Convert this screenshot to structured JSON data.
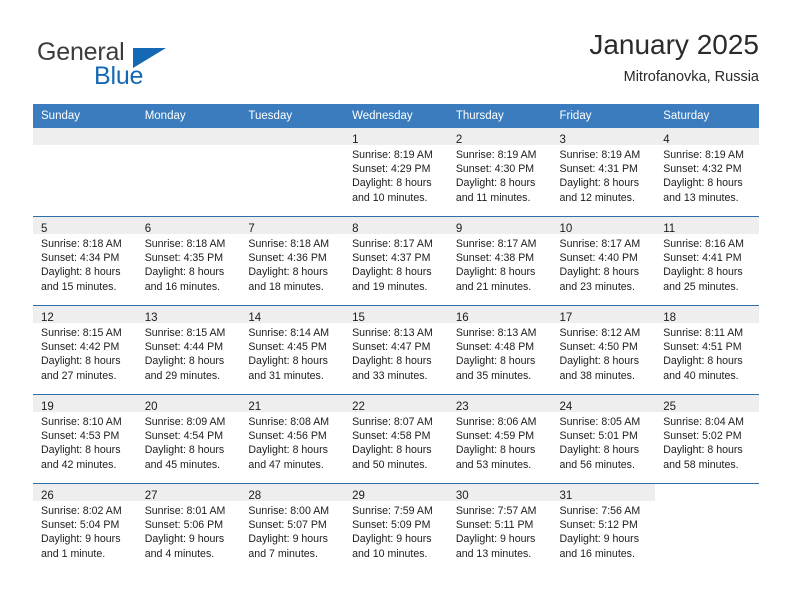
{
  "brand": {
    "name_top": "General",
    "name_bottom": "Blue",
    "accent_color": "#1569b4",
    "triangle_icon": "brand-triangle-icon"
  },
  "header": {
    "title": "January 2025",
    "subtitle": "Mitrofanovka, Russia"
  },
  "colors": {
    "header_row_bg": "#3a7cbe",
    "week_divider": "#2f6ea8",
    "daynum_band_bg": "#eeeeee",
    "text": "#1c1c1c"
  },
  "weekdays": [
    "Sunday",
    "Monday",
    "Tuesday",
    "Wednesday",
    "Thursday",
    "Friday",
    "Saturday"
  ],
  "weeks": [
    [
      {
        "day": "",
        "lines": [
          "",
          "",
          "",
          ""
        ]
      },
      {
        "day": "",
        "lines": [
          "",
          "",
          "",
          ""
        ]
      },
      {
        "day": "",
        "lines": [
          "",
          "",
          "",
          ""
        ]
      },
      {
        "day": "1",
        "lines": [
          "Sunrise: 8:19 AM",
          "Sunset: 4:29 PM",
          "Daylight: 8 hours",
          "and 10 minutes."
        ]
      },
      {
        "day": "2",
        "lines": [
          "Sunrise: 8:19 AM",
          "Sunset: 4:30 PM",
          "Daylight: 8 hours",
          "and 11 minutes."
        ]
      },
      {
        "day": "3",
        "lines": [
          "Sunrise: 8:19 AM",
          "Sunset: 4:31 PM",
          "Daylight: 8 hours",
          "and 12 minutes."
        ]
      },
      {
        "day": "4",
        "lines": [
          "Sunrise: 8:19 AM",
          "Sunset: 4:32 PM",
          "Daylight: 8 hours",
          "and 13 minutes."
        ]
      }
    ],
    [
      {
        "day": "5",
        "lines": [
          "Sunrise: 8:18 AM",
          "Sunset: 4:34 PM",
          "Daylight: 8 hours",
          "and 15 minutes."
        ]
      },
      {
        "day": "6",
        "lines": [
          "Sunrise: 8:18 AM",
          "Sunset: 4:35 PM",
          "Daylight: 8 hours",
          "and 16 minutes."
        ]
      },
      {
        "day": "7",
        "lines": [
          "Sunrise: 8:18 AM",
          "Sunset: 4:36 PM",
          "Daylight: 8 hours",
          "and 18 minutes."
        ]
      },
      {
        "day": "8",
        "lines": [
          "Sunrise: 8:17 AM",
          "Sunset: 4:37 PM",
          "Daylight: 8 hours",
          "and 19 minutes."
        ]
      },
      {
        "day": "9",
        "lines": [
          "Sunrise: 8:17 AM",
          "Sunset: 4:38 PM",
          "Daylight: 8 hours",
          "and 21 minutes."
        ]
      },
      {
        "day": "10",
        "lines": [
          "Sunrise: 8:17 AM",
          "Sunset: 4:40 PM",
          "Daylight: 8 hours",
          "and 23 minutes."
        ]
      },
      {
        "day": "11",
        "lines": [
          "Sunrise: 8:16 AM",
          "Sunset: 4:41 PM",
          "Daylight: 8 hours",
          "and 25 minutes."
        ]
      }
    ],
    [
      {
        "day": "12",
        "lines": [
          "Sunrise: 8:15 AM",
          "Sunset: 4:42 PM",
          "Daylight: 8 hours",
          "and 27 minutes."
        ]
      },
      {
        "day": "13",
        "lines": [
          "Sunrise: 8:15 AM",
          "Sunset: 4:44 PM",
          "Daylight: 8 hours",
          "and 29 minutes."
        ]
      },
      {
        "day": "14",
        "lines": [
          "Sunrise: 8:14 AM",
          "Sunset: 4:45 PM",
          "Daylight: 8 hours",
          "and 31 minutes."
        ]
      },
      {
        "day": "15",
        "lines": [
          "Sunrise: 8:13 AM",
          "Sunset: 4:47 PM",
          "Daylight: 8 hours",
          "and 33 minutes."
        ]
      },
      {
        "day": "16",
        "lines": [
          "Sunrise: 8:13 AM",
          "Sunset: 4:48 PM",
          "Daylight: 8 hours",
          "and 35 minutes."
        ]
      },
      {
        "day": "17",
        "lines": [
          "Sunrise: 8:12 AM",
          "Sunset: 4:50 PM",
          "Daylight: 8 hours",
          "and 38 minutes."
        ]
      },
      {
        "day": "18",
        "lines": [
          "Sunrise: 8:11 AM",
          "Sunset: 4:51 PM",
          "Daylight: 8 hours",
          "and 40 minutes."
        ]
      }
    ],
    [
      {
        "day": "19",
        "lines": [
          "Sunrise: 8:10 AM",
          "Sunset: 4:53 PM",
          "Daylight: 8 hours",
          "and 42 minutes."
        ]
      },
      {
        "day": "20",
        "lines": [
          "Sunrise: 8:09 AM",
          "Sunset: 4:54 PM",
          "Daylight: 8 hours",
          "and 45 minutes."
        ]
      },
      {
        "day": "21",
        "lines": [
          "Sunrise: 8:08 AM",
          "Sunset: 4:56 PM",
          "Daylight: 8 hours",
          "and 47 minutes."
        ]
      },
      {
        "day": "22",
        "lines": [
          "Sunrise: 8:07 AM",
          "Sunset: 4:58 PM",
          "Daylight: 8 hours",
          "and 50 minutes."
        ]
      },
      {
        "day": "23",
        "lines": [
          "Sunrise: 8:06 AM",
          "Sunset: 4:59 PM",
          "Daylight: 8 hours",
          "and 53 minutes."
        ]
      },
      {
        "day": "24",
        "lines": [
          "Sunrise: 8:05 AM",
          "Sunset: 5:01 PM",
          "Daylight: 8 hours",
          "and 56 minutes."
        ]
      },
      {
        "day": "25",
        "lines": [
          "Sunrise: 8:04 AM",
          "Sunset: 5:02 PM",
          "Daylight: 8 hours",
          "and 58 minutes."
        ]
      }
    ],
    [
      {
        "day": "26",
        "lines": [
          "Sunrise: 8:02 AM",
          "Sunset: 5:04 PM",
          "Daylight: 9 hours",
          "and 1 minute."
        ]
      },
      {
        "day": "27",
        "lines": [
          "Sunrise: 8:01 AM",
          "Sunset: 5:06 PM",
          "Daylight: 9 hours",
          "and 4 minutes."
        ]
      },
      {
        "day": "28",
        "lines": [
          "Sunrise: 8:00 AM",
          "Sunset: 5:07 PM",
          "Daylight: 9 hours",
          "and 7 minutes."
        ]
      },
      {
        "day": "29",
        "lines": [
          "Sunrise: 7:59 AM",
          "Sunset: 5:09 PM",
          "Daylight: 9 hours",
          "and 10 minutes."
        ]
      },
      {
        "day": "30",
        "lines": [
          "Sunrise: 7:57 AM",
          "Sunset: 5:11 PM",
          "Daylight: 9 hours",
          "and 13 minutes."
        ]
      },
      {
        "day": "31",
        "lines": [
          "Sunrise: 7:56 AM",
          "Sunset: 5:12 PM",
          "Daylight: 9 hours",
          "and 16 minutes."
        ]
      },
      {
        "day": "",
        "lines": [
          "",
          "",
          "",
          ""
        ]
      }
    ]
  ]
}
